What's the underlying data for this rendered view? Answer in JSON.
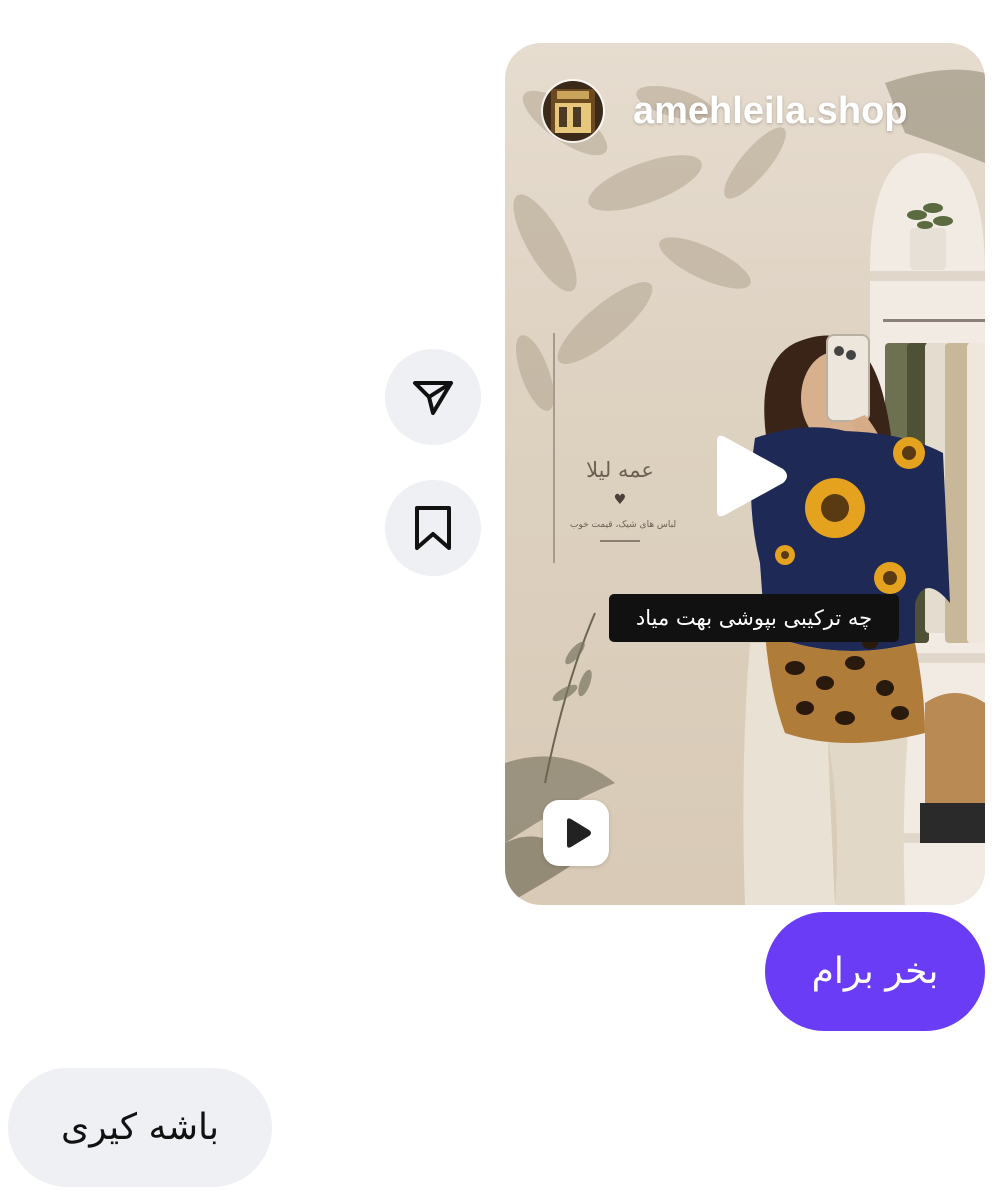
{
  "shared_reel": {
    "username": "amehleila.shop",
    "brand_name": "عمه لیلا",
    "brand_heart": "♥",
    "brand_tagline": "لباس های شیک، قیمت خوب",
    "caption": "چه ترکیبی بپوشی بهت میاد",
    "play_icon": "play-icon",
    "reel_icon": "reel-icon"
  },
  "actions": {
    "share_icon": "send-icon",
    "save_icon": "bookmark-icon"
  },
  "messages": [
    {
      "direction": "outgoing",
      "text": "بخر برام",
      "color": "#6a3cf5"
    },
    {
      "direction": "incoming",
      "text": "باشه کیری",
      "color": "#eef0f4"
    }
  ]
}
